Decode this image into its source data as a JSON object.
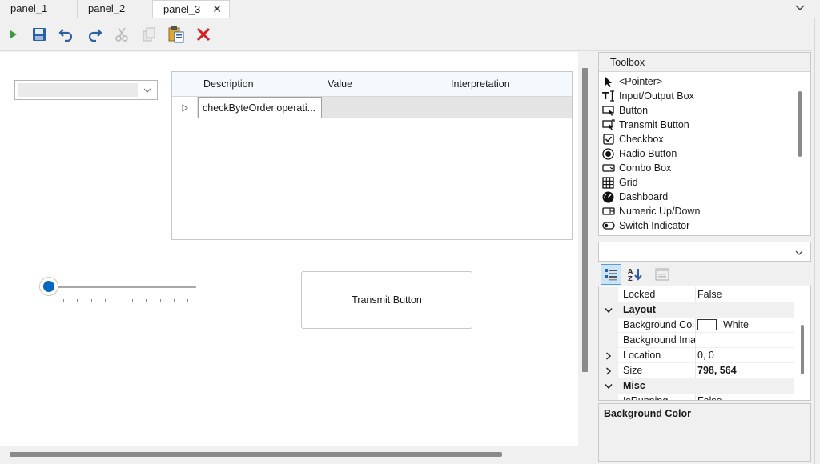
{
  "tabs": [
    {
      "label": "panel_1",
      "active": false
    },
    {
      "label": "panel_2",
      "active": false
    },
    {
      "label": "panel_3",
      "active": true
    }
  ],
  "tab_close_glyph": "✕",
  "toolbar": {
    "icons": [
      "run-icon",
      "save-icon",
      "undo-icon",
      "redo-icon",
      "cut-icon",
      "copy-icon",
      "paste-icon",
      "delete-icon"
    ]
  },
  "canvas": {
    "combo_value": "",
    "grid": {
      "columns": [
        "Description",
        "Value",
        "Interpretation"
      ],
      "rows": [
        {
          "description": "checkByteOrder.operati...",
          "value": "",
          "interpretation": ""
        }
      ]
    },
    "slider": {
      "value": 0,
      "ticks": 11
    },
    "transmit_button_label": "Transmit Button"
  },
  "toolbox": {
    "title": "Toolbox",
    "items": [
      {
        "label": "<Pointer>",
        "icon": "pointer-icon"
      },
      {
        "label": "Input/Output Box",
        "icon": "text-cursor-icon"
      },
      {
        "label": "Button",
        "icon": "button-icon"
      },
      {
        "label": "Transmit Button",
        "icon": "transmit-button-icon"
      },
      {
        "label": "Checkbox",
        "icon": "checkbox-icon"
      },
      {
        "label": "Radio Button",
        "icon": "radio-button-icon"
      },
      {
        "label": "Combo Box",
        "icon": "combo-box-icon"
      },
      {
        "label": "Grid",
        "icon": "grid-icon"
      },
      {
        "label": "Dashboard",
        "icon": "dashboard-icon"
      },
      {
        "label": "Numeric Up/Down",
        "icon": "numeric-updown-icon"
      },
      {
        "label": "Switch Indicator",
        "icon": "switch-indicator-icon"
      }
    ]
  },
  "properties": {
    "object_selector_value": "",
    "rows": [
      {
        "type": "prop",
        "name": "Locked",
        "value": "False",
        "expander": ""
      },
      {
        "type": "cat",
        "name": "Layout",
        "expander": "open"
      },
      {
        "type": "prop",
        "name": "Background Col",
        "value": "White",
        "expander": "",
        "swatch": "#ffffff"
      },
      {
        "type": "prop",
        "name": "Background Ima",
        "value": "",
        "expander": ""
      },
      {
        "type": "prop",
        "name": "Location",
        "value": "0, 0",
        "expander": "closed"
      },
      {
        "type": "prop",
        "name": "Size",
        "value": "798, 564",
        "expander": "closed",
        "bold": true
      },
      {
        "type": "cat",
        "name": "Misc",
        "expander": "open"
      },
      {
        "type": "prop",
        "name": "IsRunning",
        "value": "False",
        "expander": ""
      }
    ],
    "description_title": "Background Color"
  }
}
